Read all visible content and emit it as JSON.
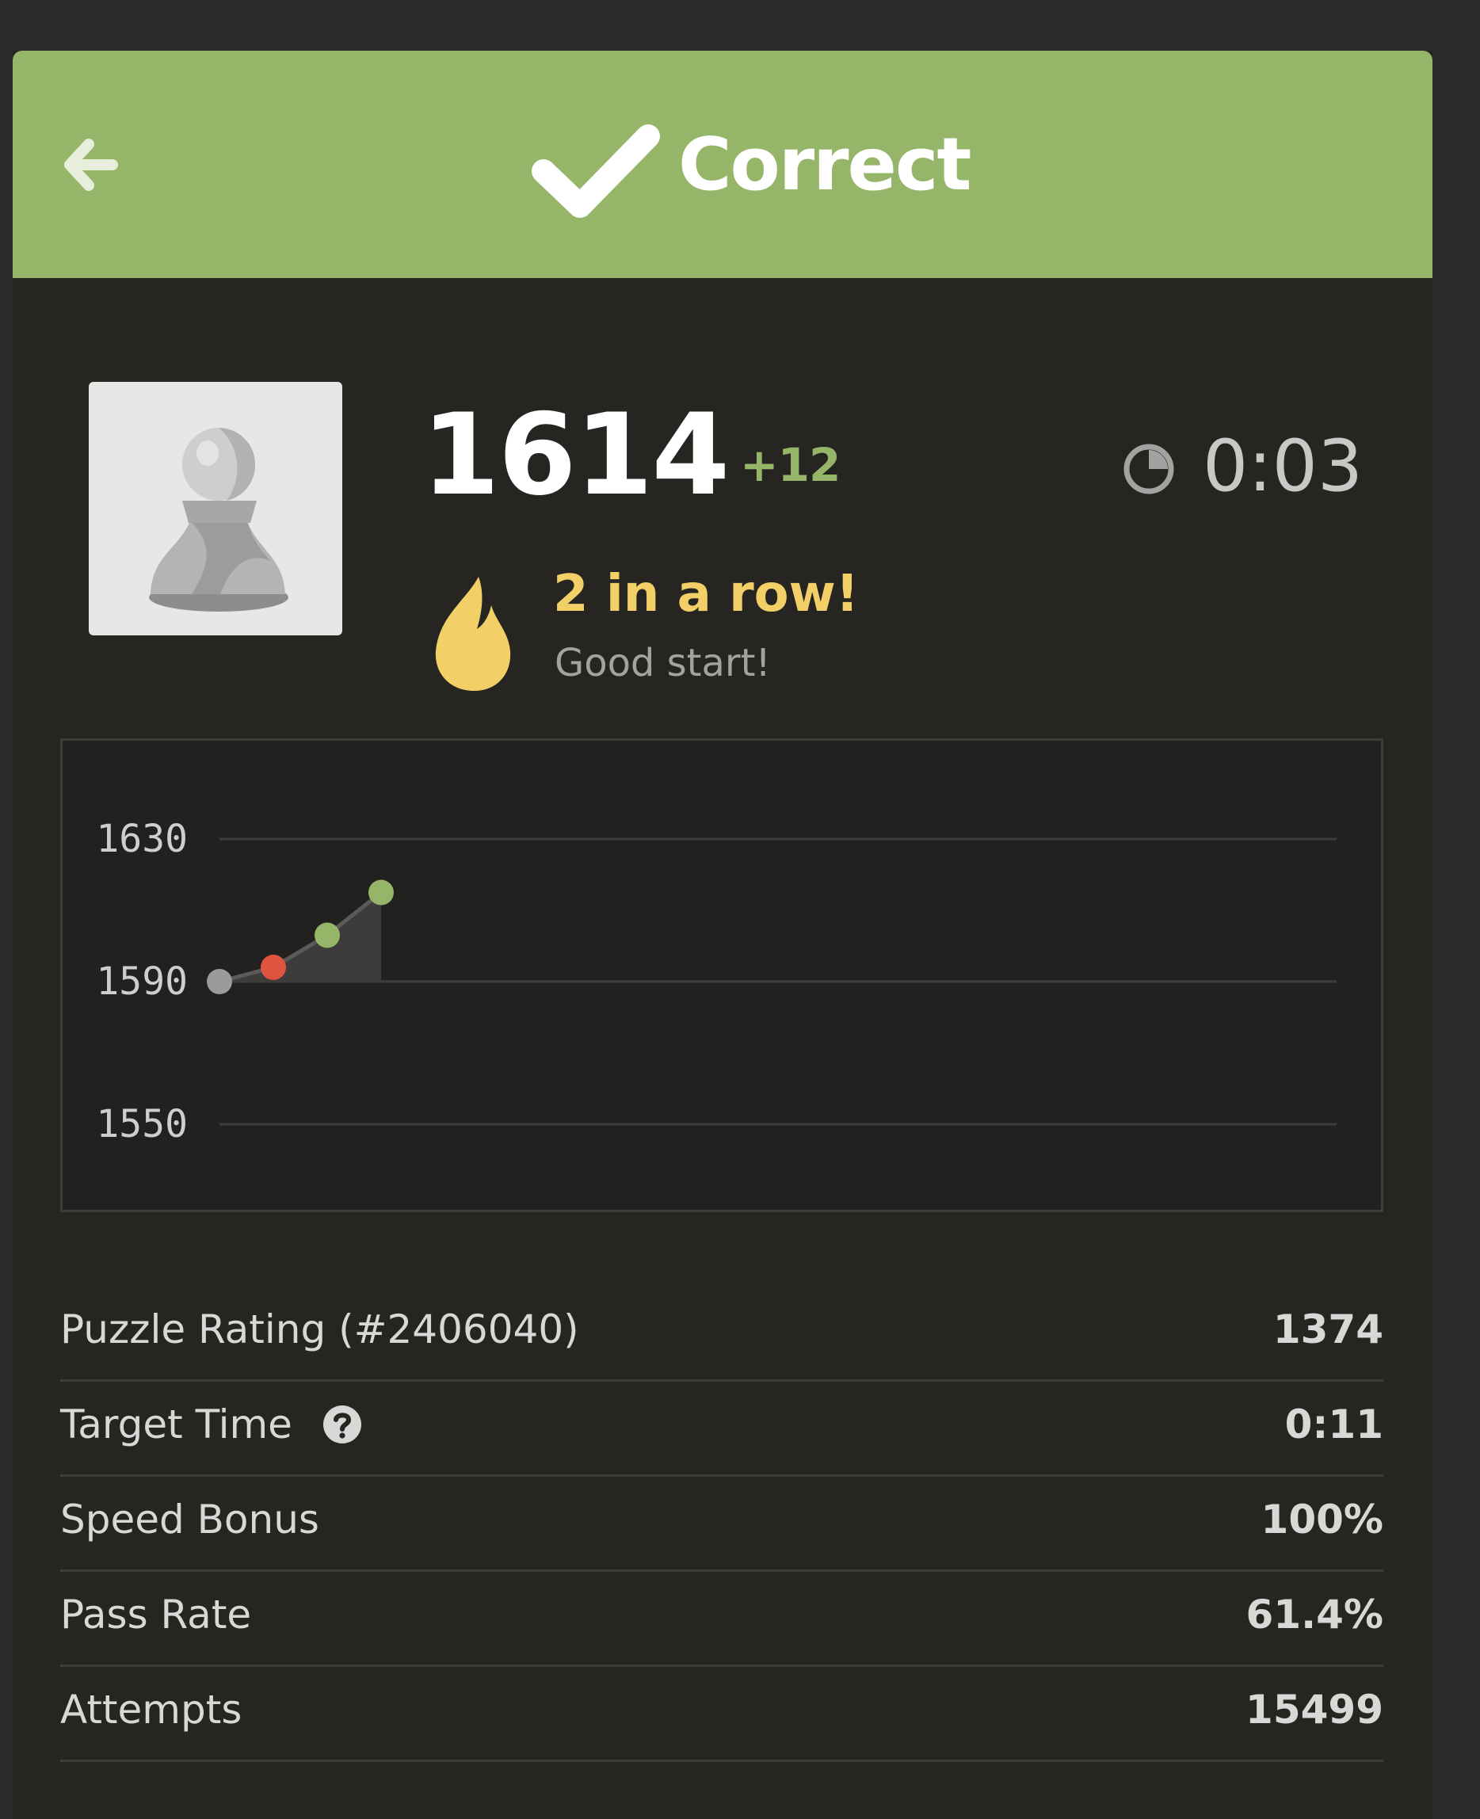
{
  "header": {
    "title": "Correct",
    "back_icon": "arrow-left-icon",
    "status_icon": "checkmark-icon",
    "color": "#95b569"
  },
  "player": {
    "avatar_icon": "pawn-icon",
    "rating": "1614",
    "rating_change": "+12",
    "timer_icon": "clock-icon",
    "time": "0:03",
    "streak_icon": "flame-icon",
    "streak_text": "2 in a row!",
    "streak_subtext": "Good start!"
  },
  "chart_data": {
    "type": "line",
    "title": "",
    "xlabel": "",
    "ylabel": "",
    "ylim": [
      1550,
      1630
    ],
    "yticks": [
      "1630",
      "1590",
      "1550"
    ],
    "x": [
      1,
      2,
      3,
      4
    ],
    "series": [
      {
        "values": [
          1590,
          1594,
          1603,
          1615
        ],
        "point_colors": [
          "#9c9b99",
          "#e0543f",
          "#95b569",
          "#95b569"
        ]
      }
    ],
    "grid": true
  },
  "stats": [
    {
      "label": "Puzzle Rating (#2406040)",
      "value": "1374"
    },
    {
      "label": "Target Time",
      "value": "0:11",
      "icon": "help-icon"
    },
    {
      "label": "Speed Bonus",
      "value": "100%"
    },
    {
      "label": "Pass Rate",
      "value": "61.4%"
    },
    {
      "label": "Attempts",
      "value": "15499"
    }
  ]
}
